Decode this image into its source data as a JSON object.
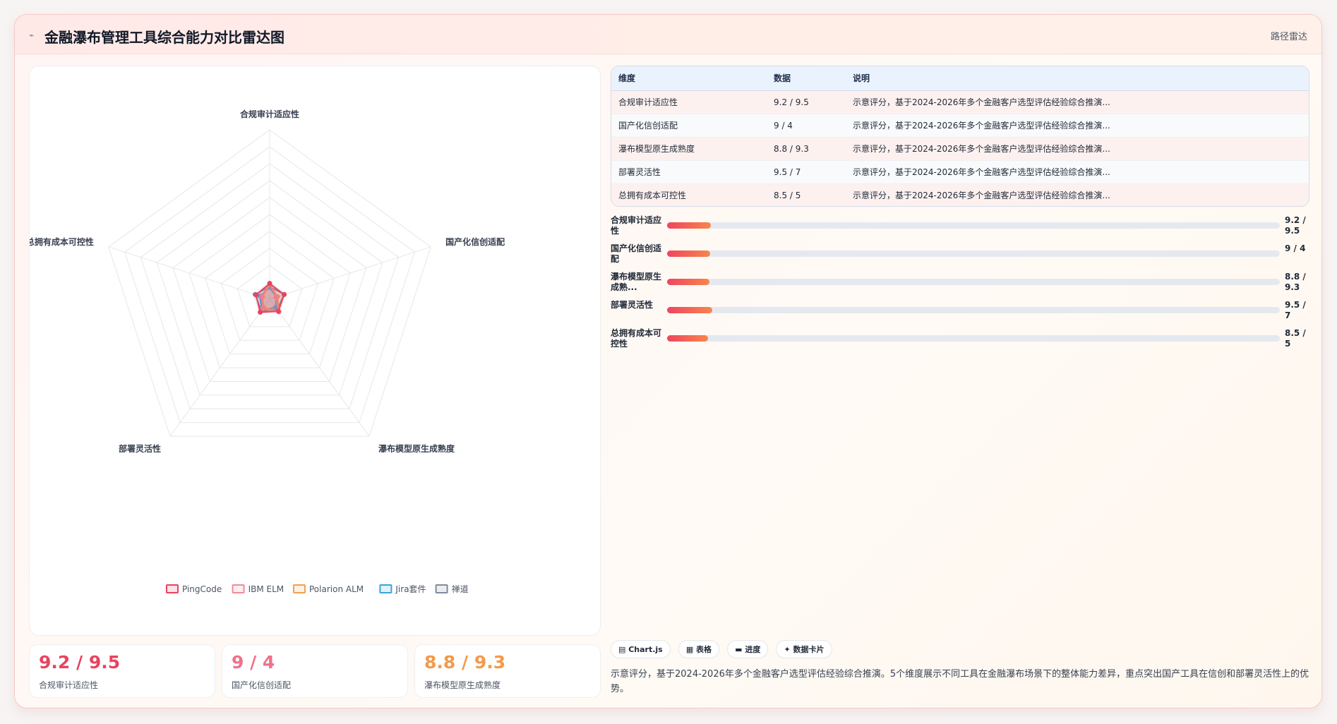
{
  "header": {
    "title_icon": "chart-line-icon",
    "title": "金融瀑布管理工具综合能力对比雷达图",
    "link": "路径雷达"
  },
  "chart_data": {
    "type": "radar",
    "title": "",
    "axes": [
      "合规审计适应性",
      "国产化信创适配",
      "瀑布模型原生成熟度",
      "部署灵活性",
      "总拥有成本可控性"
    ],
    "range": [
      0,
      100
    ],
    "grid_levels": 10,
    "series": [
      {
        "name": "PingCode",
        "values": [
          9.2,
          9,
          8.8,
          9.5,
          8.5
        ],
        "color": "#e8435f"
      },
      {
        "name": "IBM ELM",
        "values": [
          9.5,
          4,
          9.3,
          7,
          5
        ],
        "color": "#f08a9b"
      },
      {
        "name": "Polarion ALM",
        "values": [
          9,
          5,
          9,
          6,
          4.5
        ],
        "color": "#f3a04f"
      },
      {
        "name": "Jira套件",
        "values": [
          7,
          4,
          6,
          8,
          6
        ],
        "color": "#3aa3e0"
      },
      {
        "name": "禅道",
        "values": [
          7.5,
          9,
          7.5,
          8.5,
          9
        ],
        "color": "#7f8a9e"
      }
    ],
    "legend_position": "bottom"
  },
  "kpis": [
    {
      "value": "9.2 / 9.5",
      "label": "合规审计适应性",
      "color": "#e8435f"
    },
    {
      "value": "9 / 4",
      "label": "国产化信创适配",
      "color": "#f0708a"
    },
    {
      "value": "8.8 / 9.3",
      "label": "瀑布模型原生成熟度",
      "color": "#f39a4b"
    }
  ],
  "table": {
    "headers": [
      "维度",
      "数据",
      "说明"
    ],
    "rows": [
      [
        "合规审计适应性",
        "9.2 / 9.5",
        "示意评分，基于2024-2026年多个金融客户选型评估经验综合推演..."
      ],
      [
        "国产化信创适配",
        "9 / 4",
        "示意评分，基于2024-2026年多个金融客户选型评估经验综合推演..."
      ],
      [
        "瀑布模型原生成熟度",
        "8.8 / 9.3",
        "示意评分，基于2024-2026年多个金融客户选型评估经验综合推演..."
      ],
      [
        "部署灵活性",
        "9.5 / 7",
        "示意评分，基于2024-2026年多个金融客户选型评估经验综合推演..."
      ],
      [
        "总拥有成本可控性",
        "8.5 / 5",
        "示意评分，基于2024-2026年多个金融客户选型评估经验综合推演..."
      ]
    ]
  },
  "progress": [
    {
      "label": "合规审计适应性",
      "value": "9.2 / 9.5",
      "level": 9.2
    },
    {
      "label": "国产化信创适配",
      "value": "9 / 4",
      "level": 9
    },
    {
      "label": "瀑布模型原生成熟...",
      "value": "8.8 / 9.3",
      "level": 8.8
    },
    {
      "label": "部署灵活性",
      "value": "9.5 / 7",
      "level": 9.5
    },
    {
      "label": "总拥有成本可控性",
      "value": "8.5 / 5",
      "level": 8.5
    }
  ],
  "progress_max": 128,
  "chips": [
    {
      "icon": "chart-icon",
      "label": "▤ Chart.js"
    },
    {
      "icon": "table-icon",
      "label": "▦ 表格"
    },
    {
      "icon": "progress-icon",
      "label": "▬ 进度"
    },
    {
      "icon": "card-icon",
      "label": "✦ 数据卡片"
    }
  ],
  "note": "示意评分，基于2024-2026年多个金融客户选型评估经验综合推演。5个维度展示不同工具在金融瀑布场景下的整体能力差异，重点突出国产工具在信创和部署灵活性上的优势。"
}
